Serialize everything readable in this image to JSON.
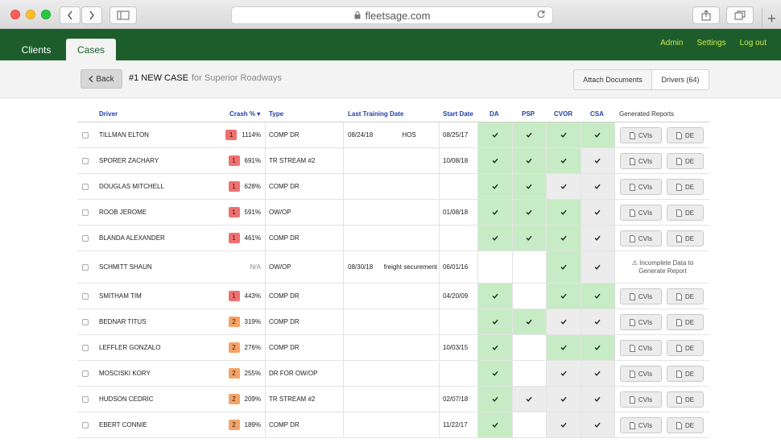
{
  "browser": {
    "url": "fleetsage.com",
    "new_tab": "+"
  },
  "nav": {
    "tabs": [
      {
        "label": "Clients"
      },
      {
        "label": "Cases"
      }
    ],
    "links": [
      {
        "label": "Admin"
      },
      {
        "label": "Settings"
      },
      {
        "label": "Log out"
      }
    ]
  },
  "case": {
    "back_label": "Back",
    "title": "#1 NEW CASE",
    "subtitle": "for Superior Roadways",
    "buttons": [
      {
        "label": "Attach Documents"
      },
      {
        "label": "Drivers (64)"
      }
    ]
  },
  "table": {
    "headers": {
      "driver": "Driver",
      "crash": "Crash %",
      "type": "Type",
      "last_training": "Last Training Date",
      "start": "Start Date",
      "da": "DA",
      "psp": "PSP",
      "cvor": "CVOR",
      "csa": "CSA",
      "reports": "Generated Reports"
    },
    "report_labels": {
      "cvi": "CVIs",
      "de": "DE"
    },
    "incomplete_text": [
      "Incomplete Data to",
      "Generate Report"
    ],
    "rows": [
      {
        "driver": "TILLMAN ELTON",
        "rank": "1",
        "crash": "1114%",
        "type": "COMP DR",
        "training_date": "08/24/18",
        "training_type": "HOS",
        "start": "08/25/17",
        "da": "green",
        "psp": "green",
        "cvor": "green",
        "csa": "green",
        "reports": true
      },
      {
        "driver": "SPORER ZACHARY",
        "rank": "1",
        "crash": "691%",
        "type": "TR STREAM #2",
        "training_date": "",
        "training_type": "",
        "start": "10/08/18",
        "da": "green",
        "psp": "green",
        "cvor": "green",
        "csa": "gray",
        "reports": true
      },
      {
        "driver": "DOUGLAS MITCHELL",
        "rank": "1",
        "crash": "628%",
        "type": "COMP DR",
        "training_date": "",
        "training_type": "",
        "start": "",
        "da": "green",
        "psp": "green",
        "cvor": "gray",
        "csa": "gray",
        "reports": true
      },
      {
        "driver": "ROOB JEROME",
        "rank": "1",
        "crash": "591%",
        "type": "OW/OP",
        "training_date": "",
        "training_type": "",
        "start": "01/08/18",
        "da": "green",
        "psp": "green",
        "cvor": "green",
        "csa": "gray",
        "reports": true
      },
      {
        "driver": "BLANDA ALEXANDER",
        "rank": "1",
        "crash": "461%",
        "type": "COMP DR",
        "training_date": "",
        "training_type": "",
        "start": "",
        "da": "green",
        "psp": "green",
        "cvor": "green",
        "csa": "gray",
        "reports": true
      },
      {
        "driver": "SCHMITT SHAUN",
        "rank": "",
        "crash": "N/A",
        "type": "OW/OP",
        "training_date": "08/30/18",
        "training_type": "freight securement",
        "start": "06/01/16",
        "da": "empty",
        "psp": "empty",
        "cvor": "green",
        "csa": "gray",
        "reports": false
      },
      {
        "driver": "SMITHAM TIM",
        "rank": "1",
        "crash": "443%",
        "type": "COMP DR",
        "training_date": "",
        "training_type": "",
        "start": "04/20/09",
        "da": "green",
        "psp": "empty",
        "cvor": "green",
        "csa": "green",
        "reports": true
      },
      {
        "driver": "BEDNAR TITUS",
        "rank": "2",
        "crash": "319%",
        "type": "COMP DR",
        "training_date": "",
        "training_type": "",
        "start": "",
        "da": "green",
        "psp": "green",
        "cvor": "gray",
        "csa": "gray",
        "reports": true
      },
      {
        "driver": "LEFFLER GONZALO",
        "rank": "2",
        "crash": "276%",
        "type": "COMP DR",
        "training_date": "",
        "training_type": "",
        "start": "10/03/15",
        "da": "green",
        "psp": "empty",
        "cvor": "green",
        "csa": "green",
        "reports": true
      },
      {
        "driver": "MOSCISKI KORY",
        "rank": "2",
        "crash": "255%",
        "type": "DR FOR OW/OP",
        "training_date": "",
        "training_type": "",
        "start": "",
        "da": "green",
        "psp": "empty",
        "cvor": "gray",
        "csa": "gray",
        "reports": true
      },
      {
        "driver": "HUDSON CEDRIC",
        "rank": "2",
        "crash": "209%",
        "type": "TR STREAM #2",
        "training_date": "",
        "training_type": "",
        "start": "02/07/18",
        "da": "green",
        "psp": "gray",
        "cvor": "gray",
        "csa": "gray",
        "reports": true
      },
      {
        "driver": "EBERT CONNIE",
        "rank": "2",
        "crash": "189%",
        "type": "COMP DR",
        "training_date": "",
        "training_type": "",
        "start": "11/22/17",
        "da": "green",
        "psp": "empty",
        "cvor": "gray",
        "csa": "gray",
        "reports": true
      }
    ]
  }
}
